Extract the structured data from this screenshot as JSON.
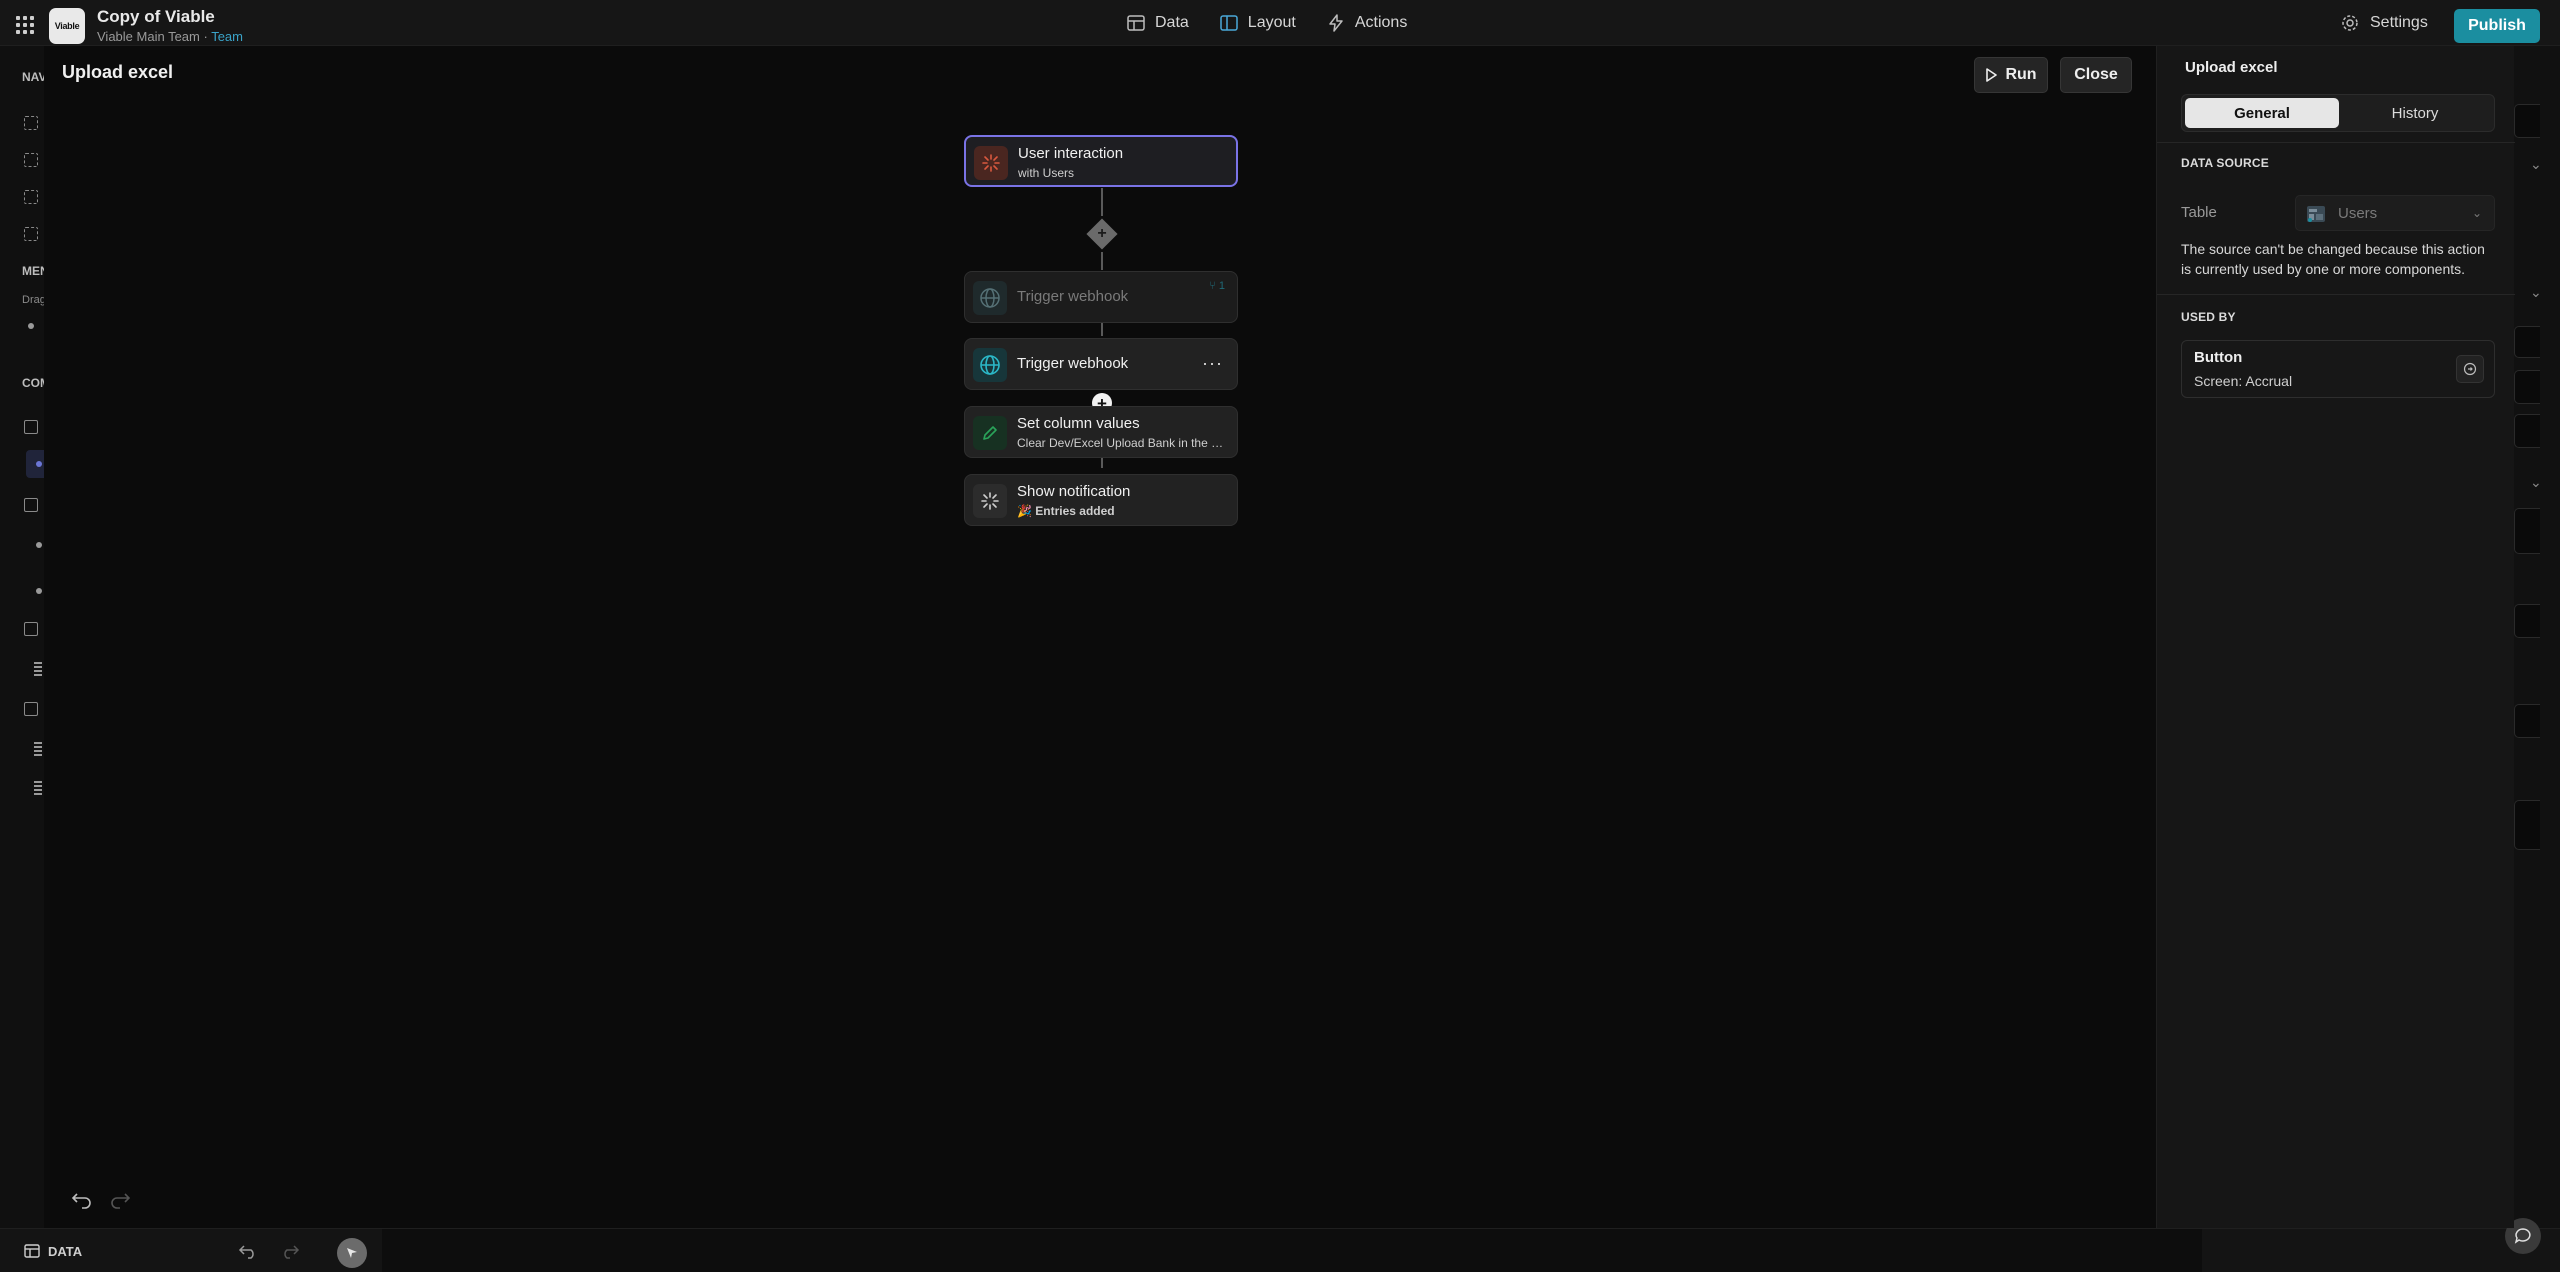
{
  "app": {
    "logo_text": "Viable",
    "name": "Copy of Viable",
    "team_name": "Viable Main Team",
    "separator": " · ",
    "team_badge": "Team"
  },
  "topnav": {
    "data": "Data",
    "layout": "Layout",
    "actions": "Actions",
    "settings": "Settings",
    "publish": "Publish"
  },
  "left_strip": {
    "nav_label": "NAV",
    "menu_label": "MEN",
    "menu_sub": "Drag",
    "components_label": "COM"
  },
  "bottom": {
    "data_label": "DATA"
  },
  "flow": {
    "title": "Upload excel",
    "run": "Run",
    "close": "Close",
    "nodes": [
      {
        "title": "User interaction",
        "subtitle": "with Users"
      },
      {
        "title": "Trigger webhook",
        "badge": "1"
      },
      {
        "title": "Trigger webhook",
        "more": "···"
      },
      {
        "title": "Set column values",
        "subtitle": "Clear Dev/Excel Upload Bank in the current row"
      },
      {
        "title": "Show notification",
        "subtitle": "🎉 Entries added"
      }
    ],
    "add_step": "+",
    "add_branch": "+"
  },
  "panel": {
    "title": "Upload excel",
    "tabs": [
      "General",
      "History"
    ],
    "data_source_heading": "DATA SOURCE",
    "table_label": "Table",
    "table_value": "Users",
    "note": "The source can't be changed because this action is currently used by one or more components.",
    "used_by_heading": "USED BY",
    "used_by": {
      "title": "Button",
      "subtitle": "Screen: Accrual"
    }
  },
  "colors": {
    "accent": "#1b8ea0",
    "selected_border": "#7a73e6",
    "trigger_icon": "#c0513c",
    "webhook_icon": "#2bb7c7",
    "set_values_icon": "#2aa45a"
  }
}
